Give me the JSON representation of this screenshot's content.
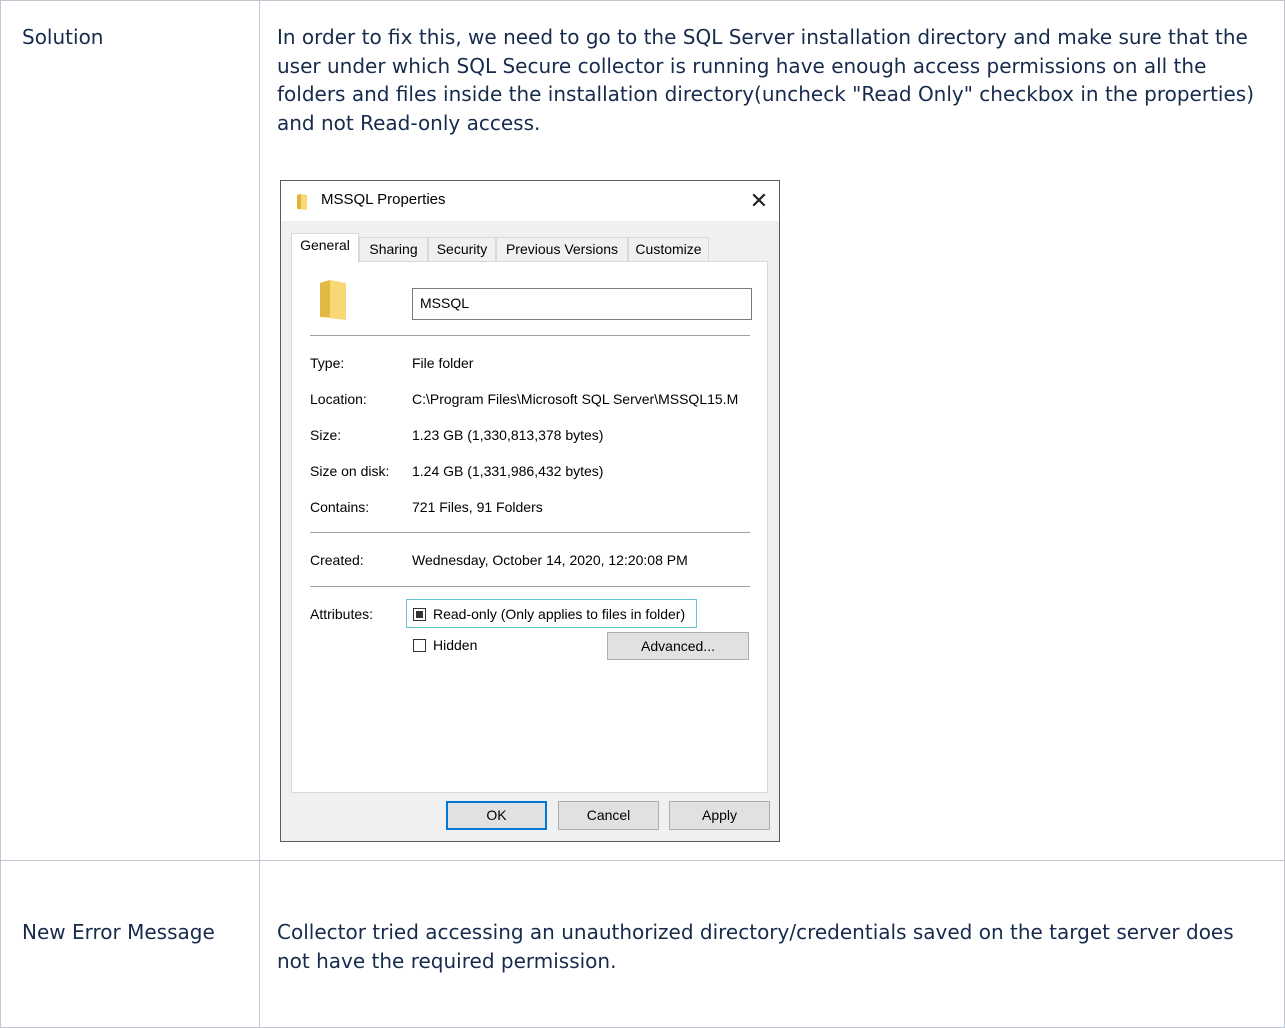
{
  "rows": [
    {
      "label": "Solution",
      "text": "In order to fix this, we need to go to the SQL Server installation directory and make sure that the user under which SQL Secure collector is running have enough access permissions on all the folders and files inside the installation directory(uncheck \"Read Only\" checkbox in the properties) and not Read-only access."
    },
    {
      "label": "New Error Message",
      "text": "Collector tried accessing an unauthorized directory/credentials saved on the target server does not have the required permission."
    }
  ],
  "dialog": {
    "title": "MSSQL Properties",
    "close_symbol": "✕",
    "tabs": [
      "General",
      "Sharing",
      "Security",
      "Previous Versions",
      "Customize"
    ],
    "active_tab": "General",
    "name_value": "MSSQL",
    "properties": [
      {
        "label": "Type:",
        "value": "File folder"
      },
      {
        "label": "Location:",
        "value": "C:\\Program Files\\Microsoft SQL Server\\MSSQL15.M"
      },
      {
        "label": "Size:",
        "value": "1.23 GB (1,330,813,378 bytes)"
      },
      {
        "label": "Size on disk:",
        "value": "1.24 GB (1,331,986,432 bytes)"
      },
      {
        "label": "Contains:",
        "value": "721 Files, 91 Folders"
      }
    ],
    "created": {
      "label": "Created:",
      "value": "Wednesday, October 14, 2020, 12:20:08 PM"
    },
    "attributes": {
      "label": "Attributes:",
      "readonly_label": "Read-only (Only applies to files in folder)",
      "readonly_state": "indeterminate",
      "hidden_label": "Hidden",
      "hidden_checked": false,
      "advanced_label": "Advanced..."
    },
    "buttons": {
      "ok": "OK",
      "cancel": "Cancel",
      "apply": "Apply"
    },
    "colors": {
      "folder": "#f8d775",
      "focus": "#63c8d0",
      "default_button": "#0078d7"
    }
  }
}
